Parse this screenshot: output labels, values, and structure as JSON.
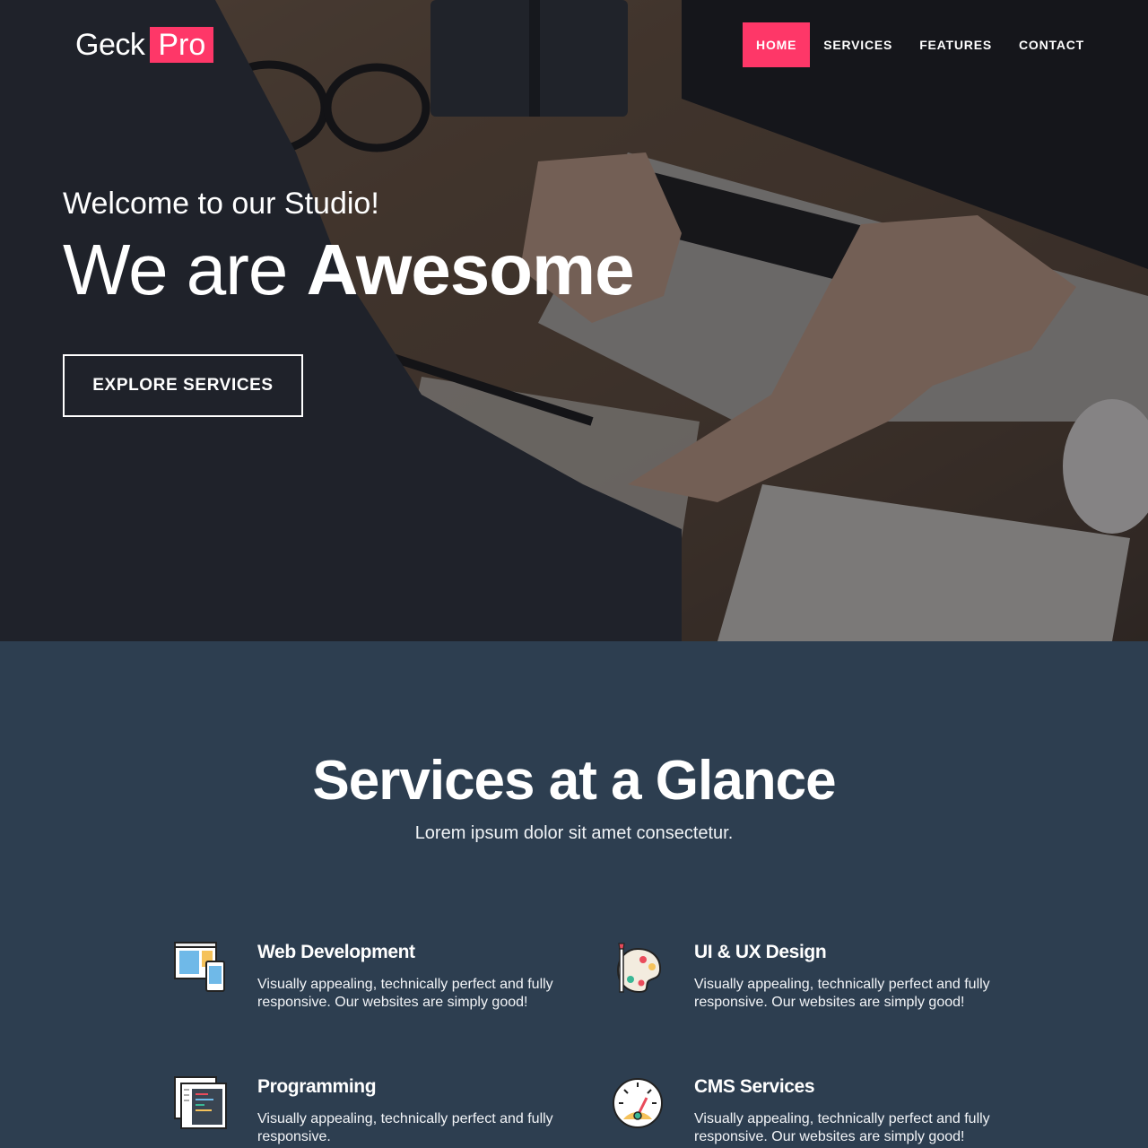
{
  "colors": {
    "accent": "#fe3768",
    "services_bg": "#2d3e50"
  },
  "logo": {
    "part1": "Geck",
    "part2": "Pro"
  },
  "nav": {
    "items": [
      {
        "label": "HOME",
        "active": true
      },
      {
        "label": "SERVICES",
        "active": false
      },
      {
        "label": "FEATURES",
        "active": false
      },
      {
        "label": "CONTACT",
        "active": false
      }
    ]
  },
  "hero": {
    "welcome": "Welcome to our Studio!",
    "title_light": "We are ",
    "title_bold": "Awesome",
    "button_label": "EXPLORE SERVICES"
  },
  "services": {
    "title": "Services at a Glance",
    "subtitle": "Lorem ipsum dolor sit amet consectetur.",
    "items": [
      {
        "name": "Web Development",
        "description": "Visually appealing, technically perfect and fully responsive. Our websites are simply good!",
        "icon": "web-development-icon"
      },
      {
        "name": "UI & UX Design",
        "description": "Visually appealing, technically perfect and fully responsive. Our websites are simply good!",
        "icon": "palette-icon"
      },
      {
        "name": "Programming",
        "description": "Visually appealing, technically perfect and fully responsive.",
        "icon": "code-editor-icon"
      },
      {
        "name": "CMS Services",
        "description": "Visually appealing, technically perfect and fully responsive. Our websites are simply good!",
        "icon": "speedometer-icon"
      }
    ]
  }
}
